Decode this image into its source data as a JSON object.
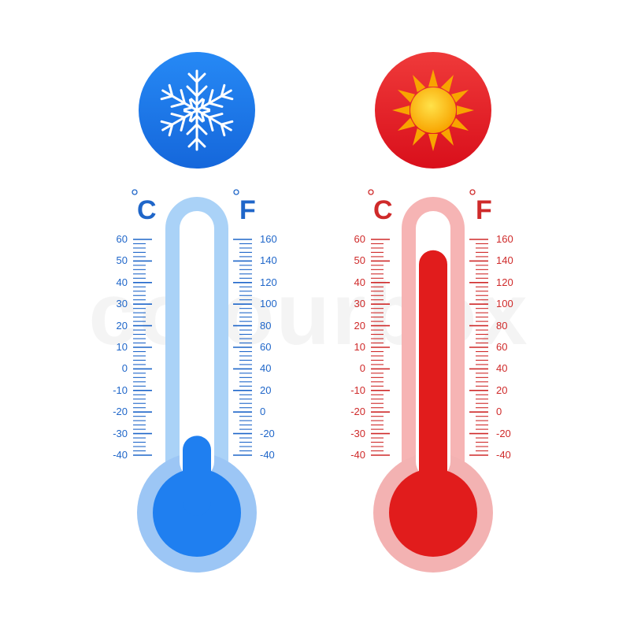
{
  "watermark": "colourbox",
  "thermometers": [
    {
      "id": "cold",
      "icon": "snowflake-icon",
      "accent": "#1f66c9",
      "tube_outer": "#aad2f7",
      "liquid": "#1f7ff0",
      "bulb_outer": "#9cc6f5",
      "badge": "#1d7ef0",
      "celsius_unit": "C",
      "fahrenheit_unit": "F",
      "celsius_scale": [
        "60",
        "50",
        "40",
        "30",
        "20",
        "10",
        "0",
        "-10",
        "-20",
        "-30",
        "-40"
      ],
      "fahrenheit_scale": [
        "160",
        "140",
        "120",
        "100",
        "80",
        "60",
        "40",
        "20",
        "0",
        "-20",
        "-40"
      ],
      "level_celsius": -31
    },
    {
      "id": "hot",
      "icon": "sun-icon",
      "accent": "#cf2a2a",
      "tube_outer": "#f6b4b4",
      "liquid": "#e11c1c",
      "bulb_outer": "#f3b2b2",
      "badge": "#e21b1b",
      "celsius_unit": "C",
      "fahrenheit_unit": "F",
      "celsius_scale": [
        "60",
        "50",
        "40",
        "30",
        "20",
        "10",
        "0",
        "-10",
        "-20",
        "-30",
        "-40"
      ],
      "fahrenheit_scale": [
        "160",
        "140",
        "120",
        "100",
        "80",
        "60",
        "40",
        "20",
        "0",
        "-20",
        "-40"
      ],
      "level_celsius": 55
    }
  ]
}
